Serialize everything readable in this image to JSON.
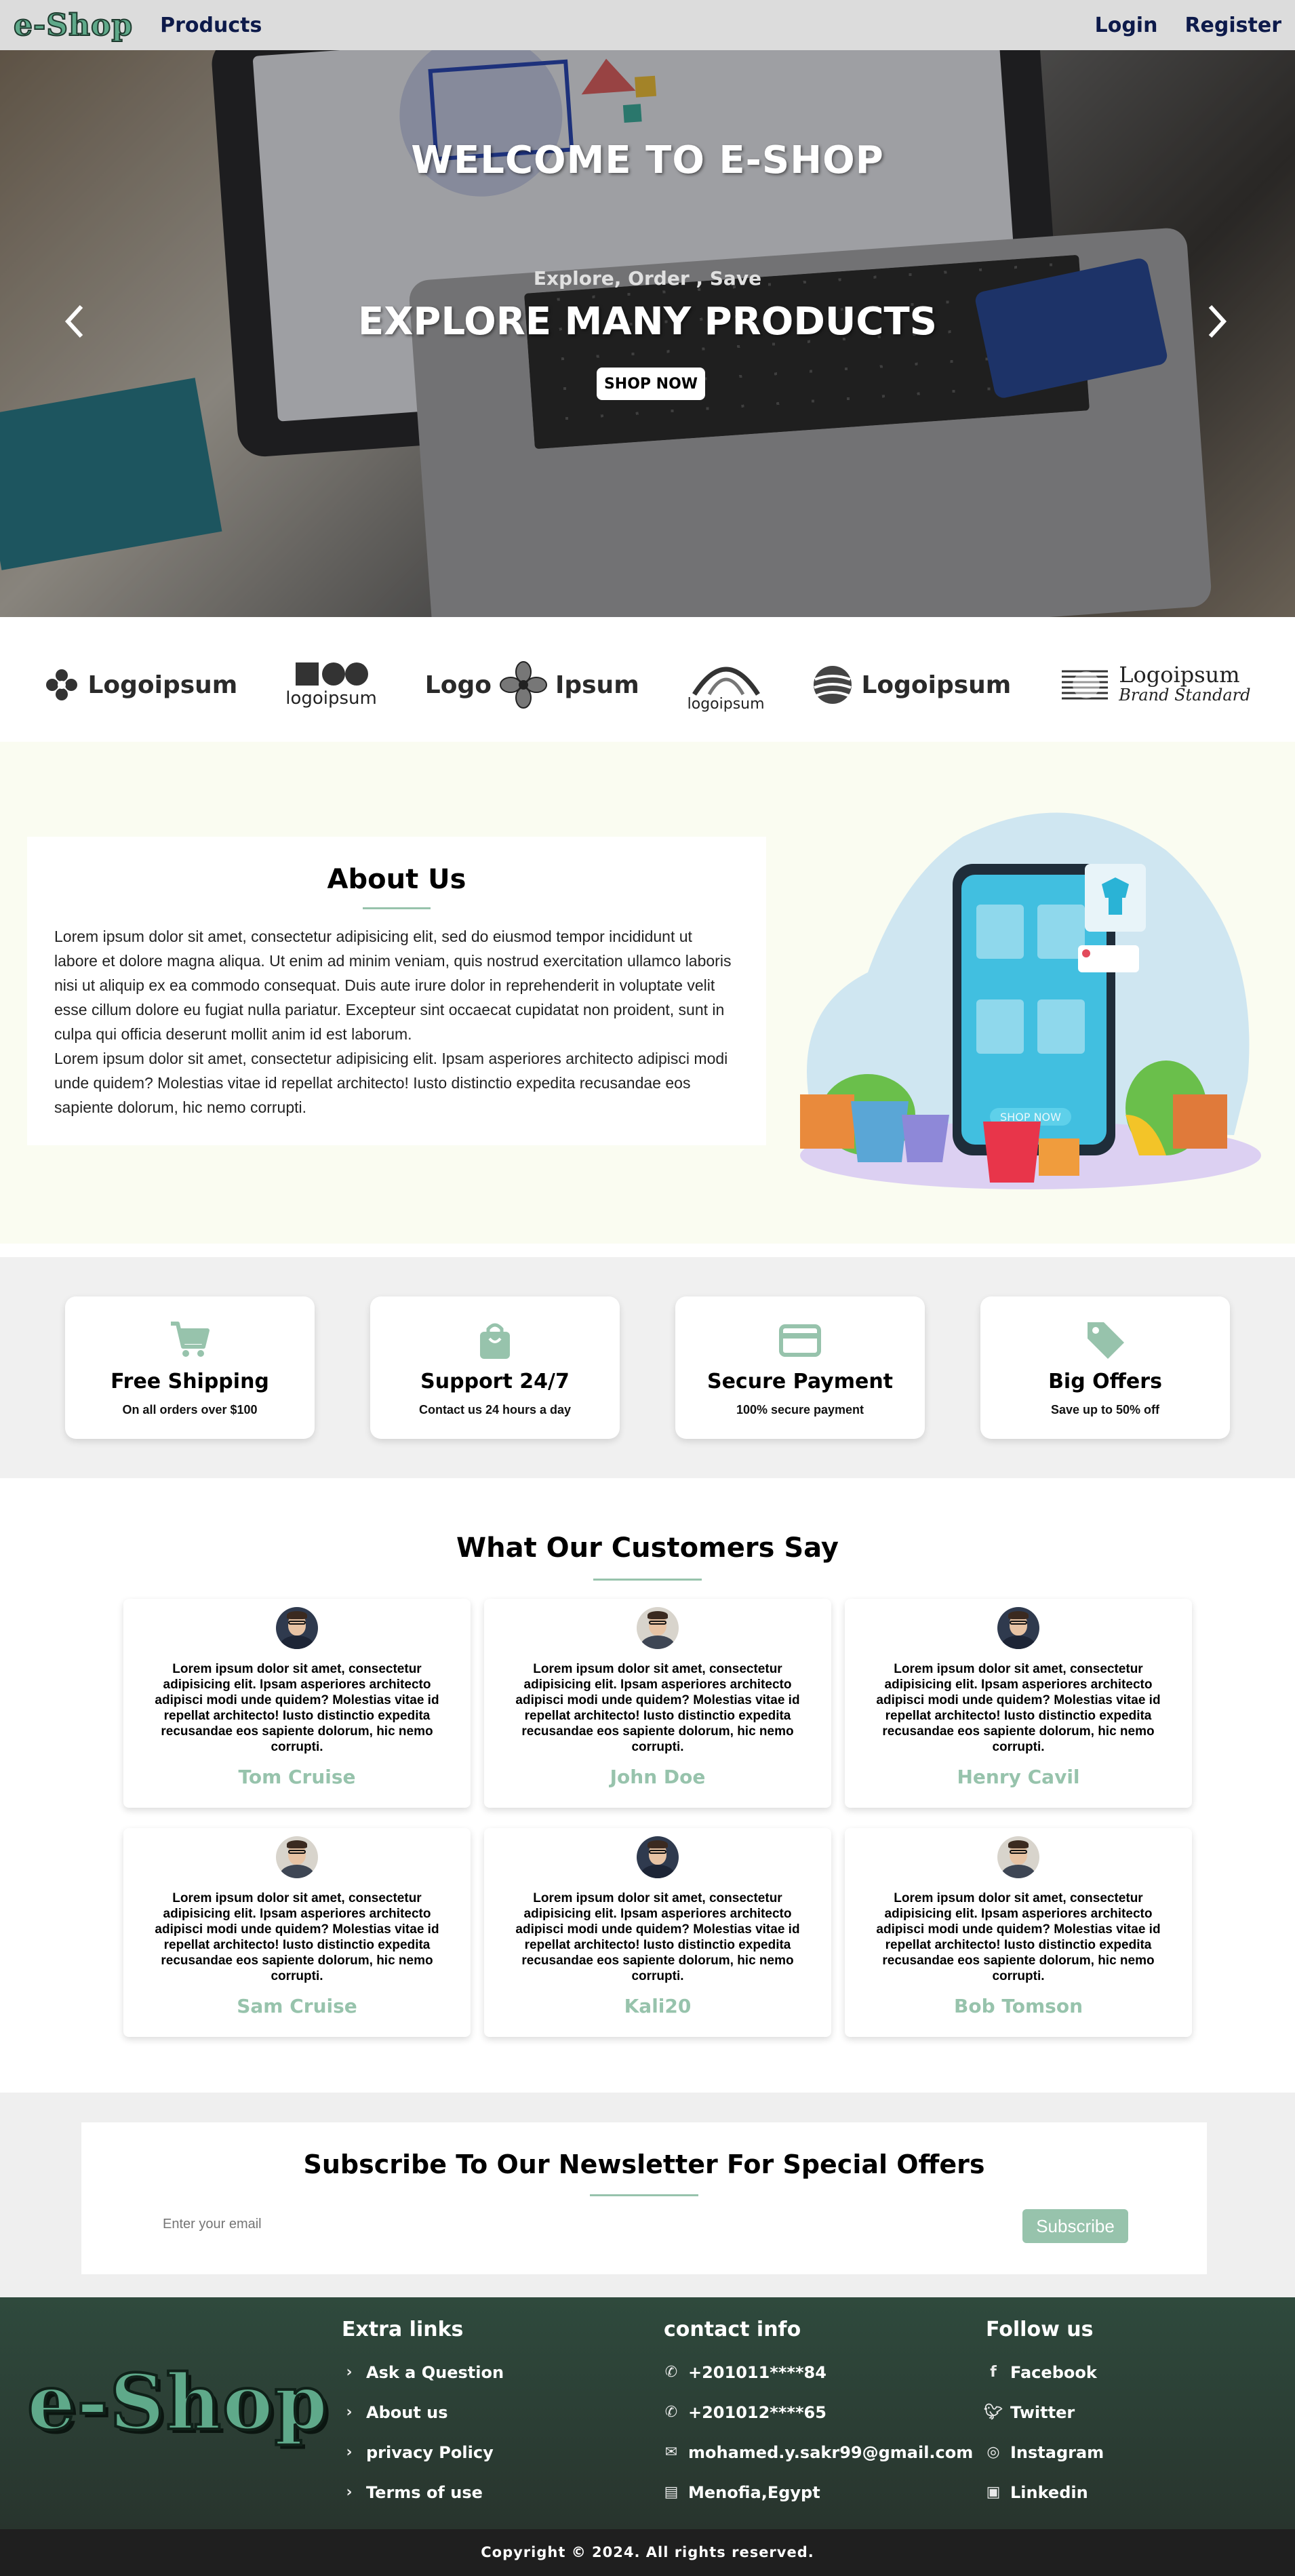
{
  "nav": {
    "logo": "e-Shop",
    "products": "Products",
    "login": "Login",
    "register": "Register"
  },
  "hero": {
    "title": "WELCOME TO E-SHOP",
    "subtitle": "Explore, Order , Save",
    "headline": "EXPLORE MANY PRODUCTS",
    "button": "SHOP NOW",
    "prev_icon": "chevron-left-icon",
    "next_icon": "chevron-right-icon"
  },
  "brands": [
    {
      "text": "Logoipsum"
    },
    {
      "text": "logoipsum"
    },
    {
      "text_a": "Logo",
      "text_b": "Ipsum"
    },
    {
      "text": "logoipsum"
    },
    {
      "text": "Logoipsum"
    },
    {
      "text": "Logoipsum",
      "tagline": "Brand Standard"
    }
  ],
  "about": {
    "title": "About Us",
    "para1": "Lorem ipsum dolor sit amet, consectetur adipisicing elit, sed do eiusmod tempor incididunt ut labore et dolore magna aliqua. Ut enim ad minim veniam, quis nostrud exercitation ullamco laboris nisi ut aliquip ex ea commodo consequat. Duis aute irure dolor in reprehenderit in voluptate velit esse cillum dolore eu fugiat nulla pariatur. Excepteur sint occaecat cupidatat non proident, sunt in culpa qui officia deserunt mollit anim id est laborum.",
    "para2": "Lorem ipsum dolor sit amet, consectetur adipisicing elit. Ipsam asperiores architecto adipisci modi unde quidem? Molestias vitae id repellat architecto! Iusto distinctio expedita recusandae eos sapiente dolorum, hic nemo corrupti.",
    "image_screen_text": "SHOP NOW"
  },
  "features": [
    {
      "icon": "cart-icon",
      "title": "Free Shipping",
      "desc": "On all orders over $100"
    },
    {
      "icon": "shopping-bag-icon",
      "title": "Support 24/7",
      "desc": "Contact us 24 hours a day"
    },
    {
      "icon": "credit-card-icon",
      "title": "Secure Payment",
      "desc": "100% secure payment"
    },
    {
      "icon": "tag-icon",
      "title": "Big Offers",
      "desc": "Save up to 50% off"
    }
  ],
  "testimonials": {
    "title": "What Our Customers Say",
    "items": [
      {
        "text": "Lorem ipsum dolor sit amet, consectetur adipisicing elit. Ipsam asperiores architecto adipisci modi unde quidem? Molestias vitae id repellat architecto! Iusto distinctio expedita recusandae eos sapiente dolorum, hic nemo corrupti.",
        "name": "Tom Cruise"
      },
      {
        "text": "Lorem ipsum dolor sit amet, consectetur adipisicing elit. Ipsam asperiores architecto adipisci modi unde quidem? Molestias vitae id repellat architecto! Iusto distinctio expedita recusandae eos sapiente dolorum, hic nemo corrupti.",
        "name": "John Doe"
      },
      {
        "text": "Lorem ipsum dolor sit amet, consectetur adipisicing elit. Ipsam asperiores architecto adipisci modi unde quidem? Molestias vitae id repellat architecto! Iusto distinctio expedita recusandae eos sapiente dolorum, hic nemo corrupti.",
        "name": "Henry Cavil"
      },
      {
        "text": "Lorem ipsum dolor sit amet, consectetur adipisicing elit. Ipsam asperiores architecto adipisci modi unde quidem? Molestias vitae id repellat architecto! Iusto distinctio expedita recusandae eos sapiente dolorum, hic nemo corrupti.",
        "name": "Sam Cruise"
      },
      {
        "text": "Lorem ipsum dolor sit amet, consectetur adipisicing elit. Ipsam asperiores architecto adipisci modi unde quidem? Molestias vitae id repellat architecto! Iusto distinctio expedita recusandae eos sapiente dolorum, hic nemo corrupti.",
        "name": "Kali20"
      },
      {
        "text": "Lorem ipsum dolor sit amet, consectetur adipisicing elit. Ipsam asperiores architecto adipisci modi unde quidem? Molestias vitae id repellat architecto! Iusto distinctio expedita recusandae eos sapiente dolorum, hic nemo corrupti.",
        "name": "Bob Tomson"
      }
    ]
  },
  "newsletter": {
    "title": "Subscribe To Our Newsletter For Special Offers",
    "placeholder": "Enter your email",
    "button": "Subscribe"
  },
  "footer": {
    "logo": "e-Shop",
    "extra": {
      "title": "Extra links",
      "items": [
        "Ask a Question",
        "About us",
        "privacy Policy",
        "Terms of use"
      ]
    },
    "contact": {
      "title": "contact info",
      "items": [
        {
          "icon": "phone-icon",
          "text": "+201011****84"
        },
        {
          "icon": "phone-icon",
          "text": "+201012****65"
        },
        {
          "icon": "envelope-icon",
          "text": "mohamed.y.sakr99@gmail.com"
        },
        {
          "icon": "map-icon",
          "text": "Menofia,Egypt"
        }
      ]
    },
    "follow": {
      "title": "Follow us",
      "items": [
        {
          "icon": "facebook-icon",
          "text": "Facebook"
        },
        {
          "icon": "twitter-icon",
          "text": "Twitter"
        },
        {
          "icon": "instagram-icon",
          "text": "Instagram"
        },
        {
          "icon": "linkedin-icon",
          "text": "Linkedin"
        }
      ]
    },
    "copyright": "Copyright © 2024. All rights reserved."
  },
  "colors": {
    "accent": "#97c3ac",
    "logo": "#5fa98a",
    "nav_bg": "#dcdcdc",
    "footer_bg": "#2f4a3d"
  }
}
